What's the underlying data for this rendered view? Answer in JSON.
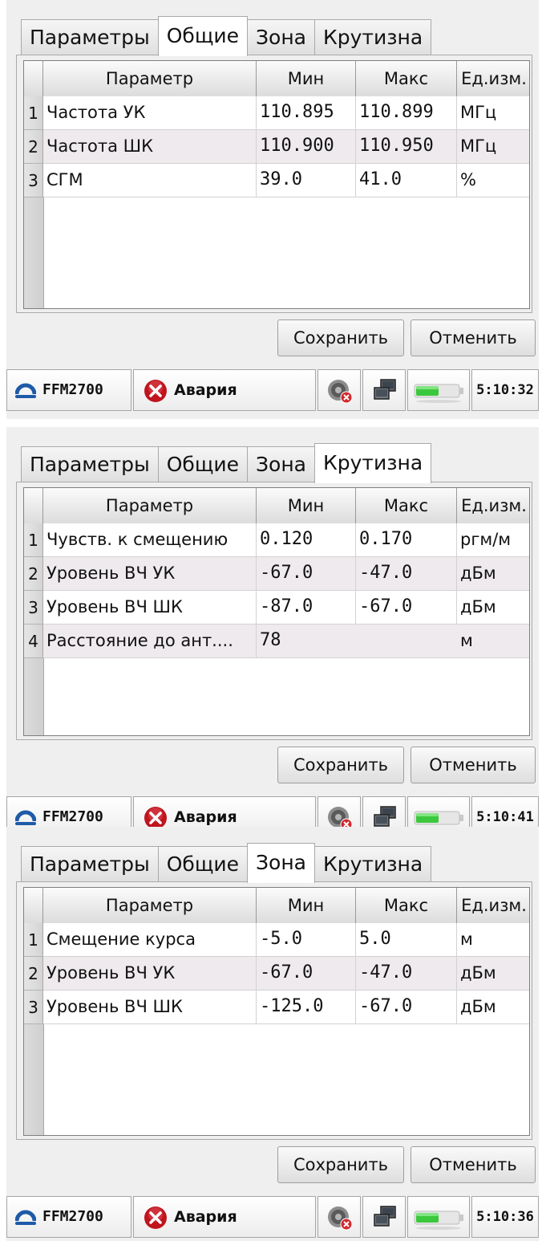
{
  "screens": [
    {
      "tabs": [
        "Параметры",
        "Общие",
        "Зона",
        "Крутизна"
      ],
      "active_tab": "Общие",
      "columns": [
        "Параметр",
        "Мин",
        "Макс",
        "Ед.изм."
      ],
      "rows": [
        {
          "num": "1",
          "param": "Частота УК",
          "min": "110.895",
          "max": "110.899",
          "unit": "МГц"
        },
        {
          "num": "2",
          "param": "Частота ШК",
          "min": "110.900",
          "max": "110.950",
          "unit": "МГц"
        },
        {
          "num": "3",
          "param": "СГМ",
          "min": "39.0",
          "max": "41.0",
          "unit": "%"
        }
      ],
      "save_label": "Сохранить",
      "cancel_label": "Отменить",
      "taskbar": {
        "device": "FFM2700",
        "status": "Авария",
        "time": "5:10:32"
      }
    },
    {
      "tabs": [
        "Параметры",
        "Общие",
        "Зона",
        "Крутизна"
      ],
      "active_tab": "Крутизна",
      "columns": [
        "Параметр",
        "Мин",
        "Макс",
        "Ед.изм."
      ],
      "rows": [
        {
          "num": "1",
          "param": "Чувств. к смещению",
          "min": "0.120",
          "max": "0.170",
          "unit": "ргм/м"
        },
        {
          "num": "2",
          "param": "Уровень ВЧ УК",
          "min": "-67.0",
          "max": "-47.0",
          "unit": "дБм"
        },
        {
          "num": "3",
          "param": "Уровень ВЧ ШК",
          "min": "-87.0",
          "max": "-67.0",
          "unit": "дБм"
        },
        {
          "num": "4",
          "param": "Расстояние до ант....",
          "value": "78",
          "unit": "м"
        }
      ],
      "save_label": "Сохранить",
      "cancel_label": "Отменить",
      "taskbar": {
        "device": "FFM2700",
        "status": "Авария",
        "time": "5:10:41"
      }
    },
    {
      "tabs": [
        "Параметры",
        "Общие",
        "Зона",
        "Крутизна"
      ],
      "active_tab": "Зона",
      "columns": [
        "Параметр",
        "Мин",
        "Макс",
        "Ед.изм."
      ],
      "rows": [
        {
          "num": "1",
          "param": "Смещение курса",
          "min": "-5.0",
          "max": "5.0",
          "unit": "м"
        },
        {
          "num": "2",
          "param": "Уровень ВЧ УК",
          "min": "-67.0",
          "max": "-47.0",
          "unit": "дБм"
        },
        {
          "num": "3",
          "param": "Уровень ВЧ ШК",
          "min": "-125.0",
          "max": "-67.0",
          "unit": "дБм"
        }
      ],
      "save_label": "Сохранить",
      "cancel_label": "Отменить",
      "taskbar": {
        "device": "FFM2700",
        "status": "Авария",
        "time": "5:10:36"
      }
    }
  ],
  "colors": {
    "panel": "#efefef",
    "alt_row": "#eeeaed",
    "alarm_red": "#c0141e",
    "logo_blue": "#1e5aa8",
    "battery_green": "#3cc83c"
  },
  "icons": [
    "logo-icon",
    "alarm-icon",
    "speaker-muted-icon",
    "network-icon",
    "battery-icon"
  ]
}
